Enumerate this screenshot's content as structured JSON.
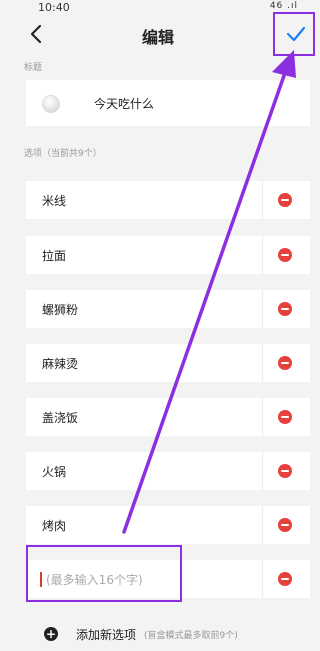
{
  "status_bar": {
    "time": "10:40",
    "indicators": "46 .ıl"
  },
  "header": {
    "title": "编辑",
    "back_icon": "chevron-left-icon",
    "confirm_icon": "checkmark-icon"
  },
  "title_section": {
    "label": "标题",
    "value": "今天吃什么"
  },
  "options_section": {
    "label": "选项（当前共9个）",
    "items": [
      "米线",
      "拉面",
      "螺狮粉",
      "麻辣烫",
      "盖浇饭",
      "火锅",
      "烤肉"
    ],
    "input_placeholder": "(最多输入16个字)"
  },
  "add_option": {
    "label": "添加新选项",
    "hint": "(盲盒模式最多取前9个)"
  },
  "colors": {
    "accent": "#1e7ff0",
    "remove": "#e5413a",
    "annotation": "#8b2fe0"
  }
}
